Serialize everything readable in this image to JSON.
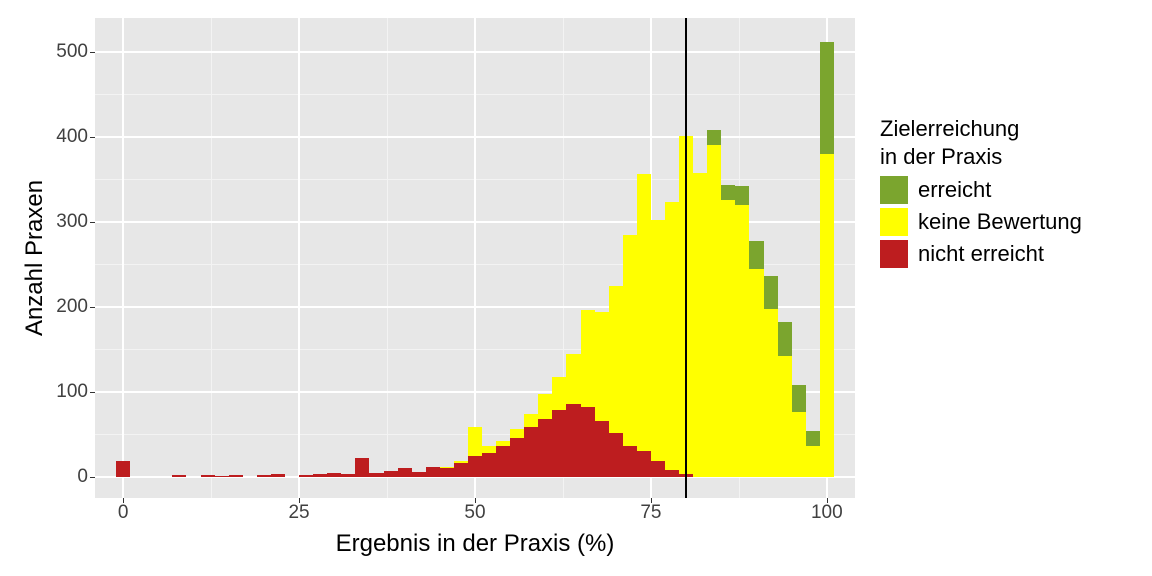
{
  "chart_data": {
    "type": "bar",
    "xlabel": "Ergebnis in der Praxis (%)",
    "ylabel": "Anzahl Praxen",
    "xlim": [
      -4,
      104
    ],
    "ylim": [
      -25,
      540
    ],
    "x_ticks": [
      0,
      25,
      50,
      75,
      100
    ],
    "y_ticks": [
      0,
      100,
      200,
      300,
      400,
      500
    ],
    "y_minor": [
      50,
      150,
      250,
      350,
      450
    ],
    "x_minor": [
      12.5,
      37.5,
      62.5,
      87.5
    ],
    "vline_at": 80,
    "binwidth": 2.0,
    "legend_title": "Zielerreichung\nin der Praxis",
    "series_order": [
      "nicht erreicht",
      "keine Bewertung",
      "erreicht"
    ],
    "series_colors": {
      "erreicht": "#7ba52e",
      "keine Bewertung": "#ffff00",
      "nicht erreicht": "#bd1d1f"
    },
    "legend_labels": {
      "erreicht": "erreicht",
      "keine Bewertung": "keine Bewertung",
      "nicht erreicht": "nicht erreicht"
    },
    "bins": [
      {
        "center": 0,
        "nicht erreicht": 19,
        "keine Bewertung": 0,
        "erreicht": 0
      },
      {
        "center": 2,
        "nicht erreicht": 0,
        "keine Bewertung": 0,
        "erreicht": 0
      },
      {
        "center": 4,
        "nicht erreicht": 0,
        "keine Bewertung": 0,
        "erreicht": 0
      },
      {
        "center": 6,
        "nicht erreicht": 0,
        "keine Bewertung": 0,
        "erreicht": 0
      },
      {
        "center": 8,
        "nicht erreicht": 2,
        "keine Bewertung": 0,
        "erreicht": 0
      },
      {
        "center": 10,
        "nicht erreicht": 0,
        "keine Bewertung": 0,
        "erreicht": 0
      },
      {
        "center": 12,
        "nicht erreicht": 2,
        "keine Bewertung": 0,
        "erreicht": 0
      },
      {
        "center": 14,
        "nicht erreicht": 1,
        "keine Bewertung": 0,
        "erreicht": 0
      },
      {
        "center": 16,
        "nicht erreicht": 2,
        "keine Bewertung": 0,
        "erreicht": 0
      },
      {
        "center": 18,
        "nicht erreicht": 0,
        "keine Bewertung": 0,
        "erreicht": 0
      },
      {
        "center": 20,
        "nicht erreicht": 2,
        "keine Bewertung": 0,
        "erreicht": 0
      },
      {
        "center": 22,
        "nicht erreicht": 3,
        "keine Bewertung": 0,
        "erreicht": 0
      },
      {
        "center": 24,
        "nicht erreicht": 0,
        "keine Bewertung": 0,
        "erreicht": 0
      },
      {
        "center": 26,
        "nicht erreicht": 2,
        "keine Bewertung": 0,
        "erreicht": 0
      },
      {
        "center": 28,
        "nicht erreicht": 3,
        "keine Bewertung": 0,
        "erreicht": 0
      },
      {
        "center": 30,
        "nicht erreicht": 5,
        "keine Bewertung": 0,
        "erreicht": 0
      },
      {
        "center": 32,
        "nicht erreicht": 3,
        "keine Bewertung": 0,
        "erreicht": 0
      },
      {
        "center": 34,
        "nicht erreicht": 22,
        "keine Bewertung": 0,
        "erreicht": 0
      },
      {
        "center": 36,
        "nicht erreicht": 4,
        "keine Bewertung": 0,
        "erreicht": 0
      },
      {
        "center": 38,
        "nicht erreicht": 7,
        "keine Bewertung": 0,
        "erreicht": 0
      },
      {
        "center": 40,
        "nicht erreicht": 10,
        "keine Bewertung": 0,
        "erreicht": 0
      },
      {
        "center": 42,
        "nicht erreicht": 6,
        "keine Bewertung": 0,
        "erreicht": 0
      },
      {
        "center": 44,
        "nicht erreicht": 12,
        "keine Bewertung": 0,
        "erreicht": 0
      },
      {
        "center": 46,
        "nicht erreicht": 10,
        "keine Bewertung": 2,
        "erreicht": 0
      },
      {
        "center": 48,
        "nicht erreicht": 16,
        "keine Bewertung": 3,
        "erreicht": 0
      },
      {
        "center": 50,
        "nicht erreicht": 25,
        "keine Bewertung": 34,
        "erreicht": 0
      },
      {
        "center": 52,
        "nicht erreicht": 28,
        "keine Bewertung": 8,
        "erreicht": 0
      },
      {
        "center": 54,
        "nicht erreicht": 36,
        "keine Bewertung": 6,
        "erreicht": 0
      },
      {
        "center": 56,
        "nicht erreicht": 46,
        "keine Bewertung": 10,
        "erreicht": 0
      },
      {
        "center": 58,
        "nicht erreicht": 58,
        "keine Bewertung": 16,
        "erreicht": 0
      },
      {
        "center": 60,
        "nicht erreicht": 68,
        "keine Bewertung": 30,
        "erreicht": 0
      },
      {
        "center": 62,
        "nicht erreicht": 78,
        "keine Bewertung": 40,
        "erreicht": 0
      },
      {
        "center": 64,
        "nicht erreicht": 86,
        "keine Bewertung": 58,
        "erreicht": 0
      },
      {
        "center": 66,
        "nicht erreicht": 82,
        "keine Bewertung": 114,
        "erreicht": 0
      },
      {
        "center": 68,
        "nicht erreicht": 66,
        "keine Bewertung": 128,
        "erreicht": 0
      },
      {
        "center": 70,
        "nicht erreicht": 52,
        "keine Bewertung": 172,
        "erreicht": 0
      },
      {
        "center": 72,
        "nicht erreicht": 36,
        "keine Bewertung": 248,
        "erreicht": 0
      },
      {
        "center": 74,
        "nicht erreicht": 30,
        "keine Bewertung": 326,
        "erreicht": 0
      },
      {
        "center": 76,
        "nicht erreicht": 18,
        "keine Bewertung": 284,
        "erreicht": 0
      },
      {
        "center": 78,
        "nicht erreicht": 8,
        "keine Bewertung": 316,
        "erreicht": 0
      },
      {
        "center": 80,
        "nicht erreicht": 3,
        "keine Bewertung": 398,
        "erreicht": 0
      },
      {
        "center": 82,
        "nicht erreicht": 0,
        "keine Bewertung": 358,
        "erreicht": 0
      },
      {
        "center": 84,
        "nicht erreicht": 0,
        "keine Bewertung": 390,
        "erreicht": 18
      },
      {
        "center": 86,
        "nicht erreicht": 0,
        "keine Bewertung": 326,
        "erreicht": 18
      },
      {
        "center": 88,
        "nicht erreicht": 0,
        "keine Bewertung": 320,
        "erreicht": 22
      },
      {
        "center": 90,
        "nicht erreicht": 0,
        "keine Bewertung": 244,
        "erreicht": 34
      },
      {
        "center": 92,
        "nicht erreicht": 0,
        "keine Bewertung": 198,
        "erreicht": 38
      },
      {
        "center": 94,
        "nicht erreicht": 0,
        "keine Bewertung": 142,
        "erreicht": 40
      },
      {
        "center": 96,
        "nicht erreicht": 0,
        "keine Bewertung": 76,
        "erreicht": 32
      },
      {
        "center": 98,
        "nicht erreicht": 0,
        "keine Bewertung": 36,
        "erreicht": 18
      },
      {
        "center": 100,
        "nicht erreicht": 0,
        "keine Bewertung": 380,
        "erreicht": 132
      }
    ]
  }
}
